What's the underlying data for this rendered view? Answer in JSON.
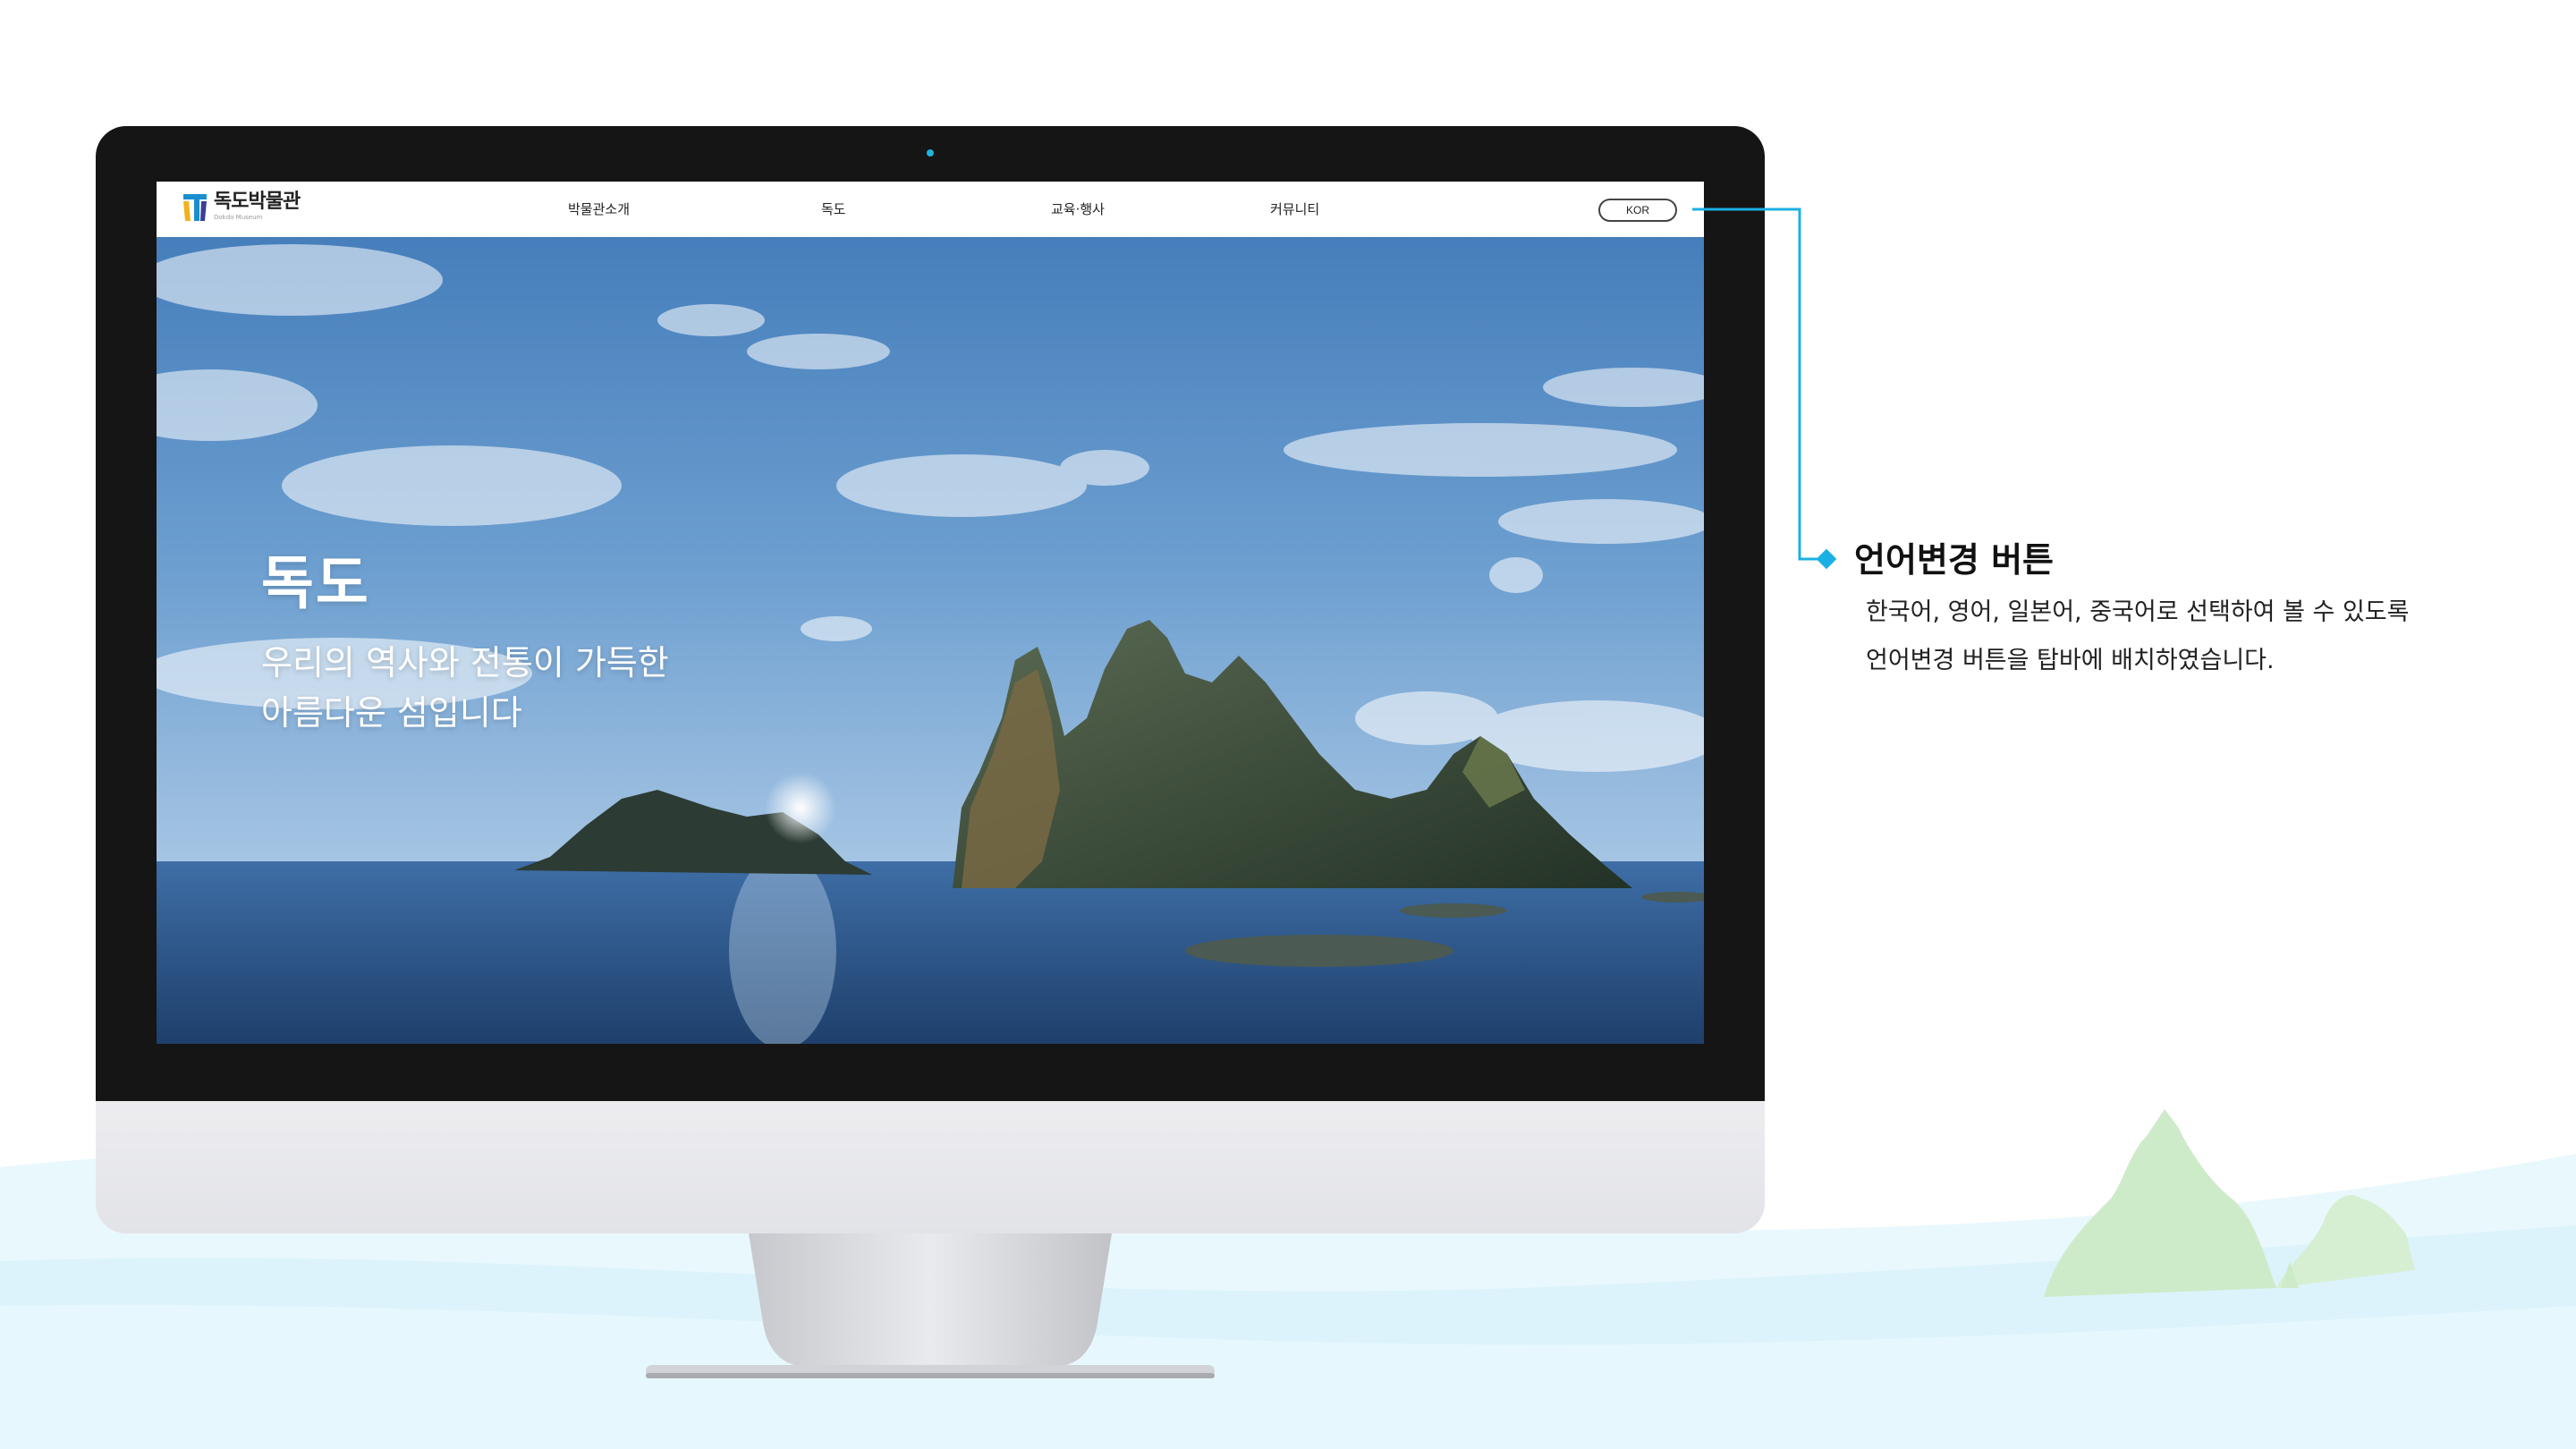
{
  "site": {
    "logo_title": "독도박물관",
    "logo_subtitle": "Dokdo Museum"
  },
  "nav": {
    "items": [
      {
        "label": "박물관소개"
      },
      {
        "label": "독도"
      },
      {
        "label": "교육·행사"
      },
      {
        "label": "커뮤니티"
      }
    ],
    "language_button": "KOR"
  },
  "hero": {
    "title": "독도",
    "desc_line1": "우리의 역사와 전통이 가득한",
    "desc_line2": "아름다운 섬입니다"
  },
  "annotation": {
    "title": "언어변경 버튼",
    "desc_line1": "한국어, 영어, 일본어, 중국어로 선택하여 볼 수 있도록",
    "desc_line2": "언어변경 버튼을 탑바에 배치하였습니다.",
    "accent_color": "#1ab0e3"
  },
  "colors": {
    "bezel": "#151515",
    "chin": "#e6e7eb",
    "wave": "#e3f6fd",
    "hill": "#cbebc9"
  }
}
